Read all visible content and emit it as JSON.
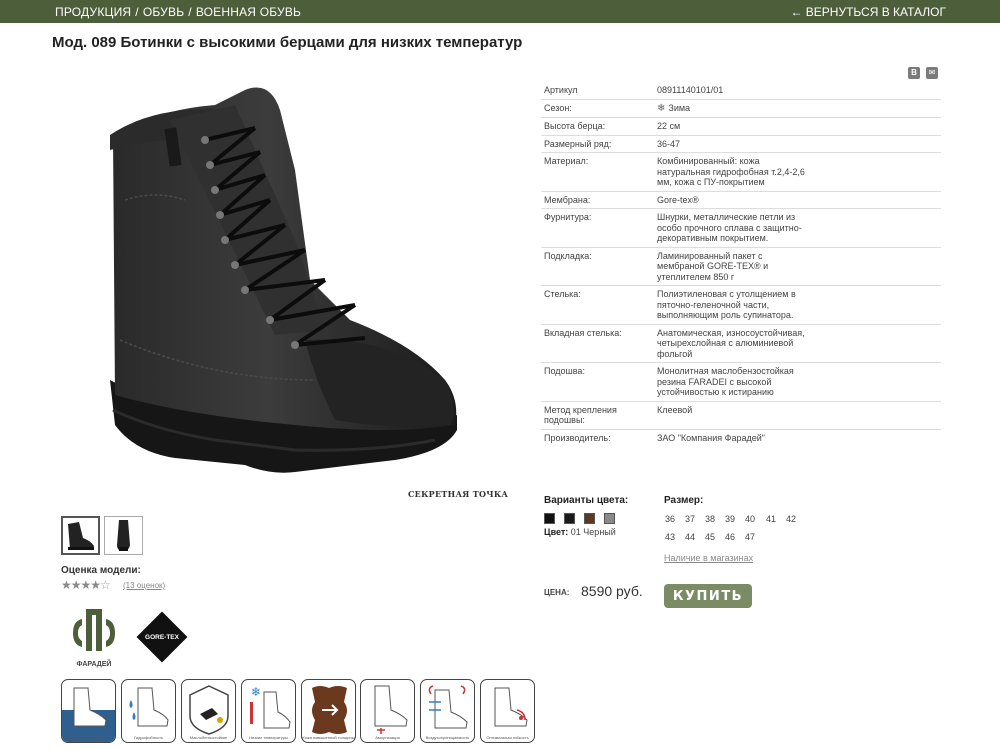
{
  "nav": {
    "crumb_1": "ПРОДУКЦИЯ",
    "crumb_2": "ОБУВЬ",
    "crumb_3": "ВОЕННАЯ ОБУВЬ",
    "separator": "/",
    "back": "← ВЕРНУТЬСЯ В КАТАЛОГ"
  },
  "product": {
    "title": "Мод. 089 Ботинки с высокими берцами для низких температур",
    "watermark": "СЕКРЕТНАЯ ТОЧКА",
    "share": [
      "В",
      "✉"
    ]
  },
  "specs": [
    {
      "label": "Артикул",
      "value": "08911140101/01"
    },
    {
      "label": "Сезон:",
      "value": "Зима",
      "icon": "snowflake-icon"
    },
    {
      "label": "Высота берца:",
      "value": "22 см"
    },
    {
      "label": "Размерный ряд:",
      "value": "36-47"
    },
    {
      "label": "Материал:",
      "value": "Комбинированный: кожа натуральная гидрофобная т.2,4-2,6 мм, кожа с ПУ-покрытием"
    },
    {
      "label": "Мембрана:",
      "value": "Gore-tex®"
    },
    {
      "label": "Фурнитура:",
      "value": "Шнурки, металлические петли из особо прочного сплава с защитно-декоративным покрытием."
    },
    {
      "label": "Подкладка:",
      "value": "Ламинированный пакет с мембраной GORE-TEX® и утеплителем 850 г"
    },
    {
      "label": "Стелька:",
      "value": "Полиэтиленовая с утолщением в пяточно-геленочной части, выполняющим роль супинатора."
    },
    {
      "label": "Вкладная стелька:",
      "value": "Анатомическая, износоустойчивая, четырехслойная с алюминиевой фольгой"
    },
    {
      "label": "Подошва:",
      "value": "Монолитная маслобензостойкая резина FARADEI с высокой устойчивостью к истиранию"
    },
    {
      "label": "Метод крепления подошвы:",
      "value": "Клеевой"
    },
    {
      "label": "Производитель:",
      "value": "ЗАО \"Компания Фарадей\""
    }
  ],
  "rating": {
    "label": "Оценка модели:",
    "stars": 4,
    "max": 5,
    "reviews": "(13 оценок)"
  },
  "colors": {
    "title": "Варианты цвета:",
    "swatches": [
      "#111111",
      "#1a1a1a",
      "#5a3a22",
      "#8a8a8a"
    ],
    "current_label": "Цвет:",
    "current_value": "01 Черный"
  },
  "sizes": {
    "title": "Размер:",
    "values": [
      "36",
      "37",
      "38",
      "39",
      "40",
      "41",
      "42",
      "43",
      "44",
      "45",
      "46",
      "47"
    ],
    "availability": "Наличие в магазинах"
  },
  "purchase": {
    "price_label": "ЦЕНА:",
    "price": "8590 руб.",
    "buy": "КУПИТЬ"
  },
  "brand": {
    "faradei_caption": "ФАРАДЕЙ",
    "goretex": "GORE-TEX"
  },
  "features": [
    "Водонепроницаемые",
    "Гидрофобность",
    "Маслобензостойкие",
    "Низкие температуры",
    "Кожа повышенной толщины",
    "Амортизация",
    "Воздухопроницаемость",
    "Оптимальная гибкость"
  ],
  "palette": {
    "nav_bg": "#4d5e3b",
    "buy_bg": "#7b8b63"
  }
}
